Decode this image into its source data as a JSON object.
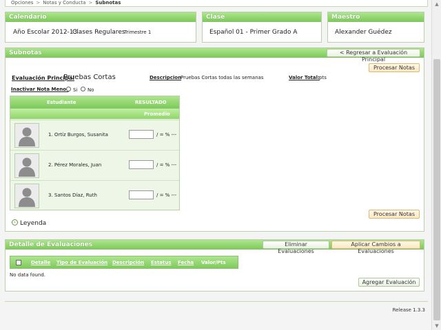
{
  "breadcrumb": {
    "items": [
      "Opciones",
      "Notas y Conducta",
      "Subnotas"
    ],
    "separator": ">"
  },
  "calendario": {
    "title": "Calendario",
    "year": "Año Escolar 2012-13",
    "type": "Clases Regulares",
    "term": "Trimestre 1"
  },
  "clase": {
    "title": "Clase",
    "value": "Español 01 -  Primer Grado  A"
  },
  "maestro": {
    "title": "Maestro",
    "value": "Alexander Guédez"
  },
  "subnotas": {
    "title": "Subnotas",
    "back_button": "< Regresar a Evaluación Principal",
    "process_button": "Procesar Notas",
    "eval_label": "Evaluación Principal",
    "eval_value": "Pruebas Cortas",
    "desc_label": "Descripcion",
    "desc_value": "Pruebas Cortas todas las semanas",
    "total_label": "Valor Total:",
    "total_value": "pts",
    "inactivar_label": "Inactivar Nota Menor",
    "radio_si": "Si",
    "radio_no": "No",
    "grid": {
      "col_student": "Estudiante",
      "col_result": "RESULTADO",
      "col_avg": "Promedio",
      "rows": [
        {
          "name": "1. Ortíz Burgos, Susanita",
          "pct": "/ = % ---"
        },
        {
          "name": "2. Pérez Morales, Juan",
          "pct": "/ = % ---"
        },
        {
          "name": "3. Santos Díaz, Ruth",
          "pct": "/ = % ---"
        }
      ]
    },
    "legend": "Leyenda"
  },
  "detalle": {
    "title": "Detalle de Evaluaciones",
    "delete_button": "Eliminar Evaluaciones",
    "apply_button": "Aplicar Cambios a Evaluaciones",
    "columns": [
      "Detalle",
      "Tipo de Evaluación",
      "Descripción",
      "Estatus",
      "Fecha",
      "Valor/Pts"
    ],
    "empty_text": "No data found.",
    "add_button": "Agregar Evaluación"
  },
  "footer": {
    "release": "Release 1.3.3"
  },
  "colors": {
    "header_green": "#7ecb5a",
    "border_green": "#b8cfa8",
    "orange_btn": "#fbe8c3"
  }
}
